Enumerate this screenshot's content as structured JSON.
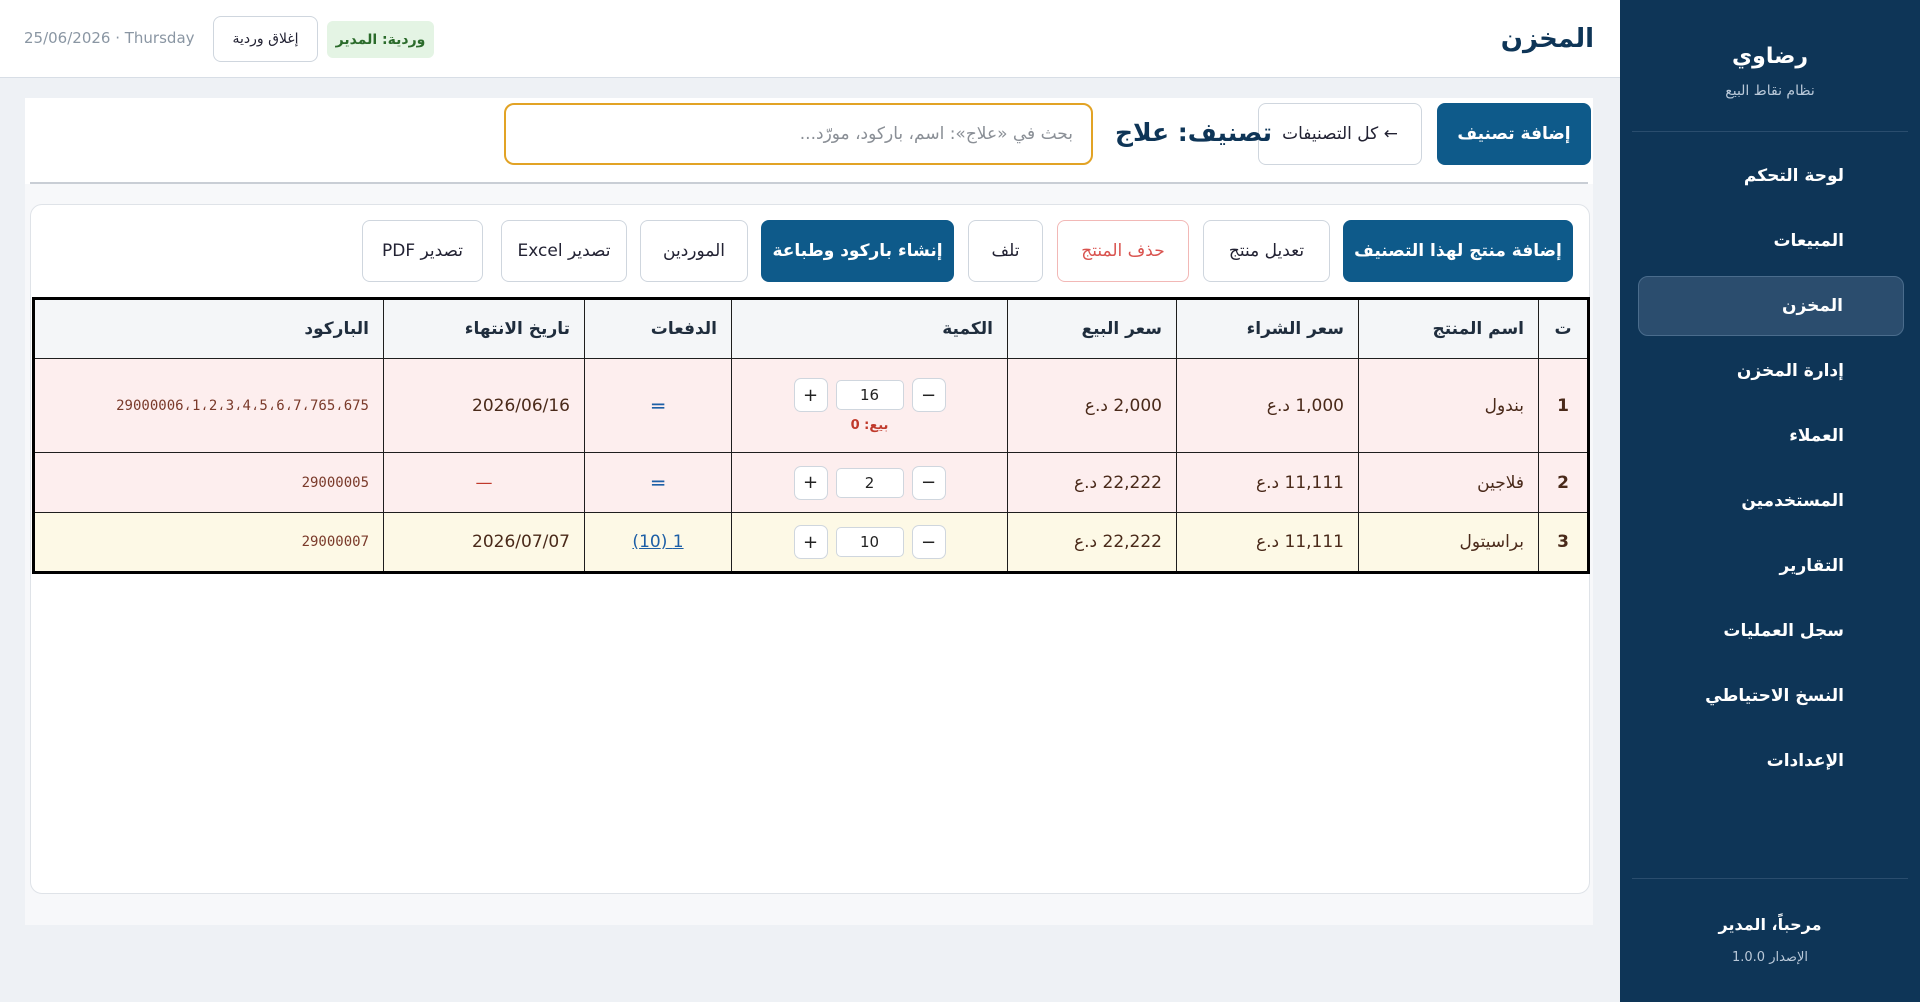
{
  "sidebar": {
    "brand": "رضاوي",
    "subtitle": "نظام نقاط البيع",
    "items": [
      {
        "label": "لوحة التحكم"
      },
      {
        "label": "المبيعات"
      },
      {
        "label": "المخزن"
      },
      {
        "label": "إدارة المخزن"
      },
      {
        "label": "العملاء"
      },
      {
        "label": "المستخدمين"
      },
      {
        "label": "التقارير"
      },
      {
        "label": "سجل العمليات"
      },
      {
        "label": "النسخ الاحتياطي"
      },
      {
        "label": "الإعدادات"
      }
    ],
    "active_index": 2,
    "welcome": "مرحباً، المدير",
    "version": "الإصدار 1.0.0"
  },
  "topbar": {
    "title": "المخزن",
    "shift_badge": "وردية: المدير",
    "close_shift": "إغلاق وردية",
    "date": "25/06/2026 · Thursday"
  },
  "category_bar": {
    "add_category": "إضافة تصنيف",
    "all_categories": "← كل التصنيفات",
    "title": "تصنيف: علاج",
    "search_placeholder": "بحث في «علاج»: اسم، باركود، مورّد..."
  },
  "actions": {
    "add_product": "إضافة منتج لهذا التصنيف",
    "edit_product": "تعديل منتج",
    "delete_product": "حذف المنتج",
    "damage": "تلف",
    "barcode_print": "إنشاء باركود وطباعة",
    "suppliers": "الموردين",
    "export_excel": "تصدير Excel",
    "export_pdf": "تصدير PDF"
  },
  "table": {
    "headers": {
      "index": "ت",
      "name": "اسم المنتج",
      "buy_price": "سعر الشراء",
      "sell_price": "سعر البيع",
      "quantity": "الكمية",
      "batches": "الدفعات",
      "expiry": "تاريخ الانتهاء",
      "barcode": "الباركود"
    },
    "rows": [
      {
        "index": "1",
        "name": "بندول",
        "buy_price": "1,000 د.ع",
        "sell_price": "2,000 د.ع",
        "quantity": "16",
        "sold": "بيع: 0",
        "batches": "═",
        "expiry": "2026/06/16",
        "barcode": "29000006،1،2،3،4،5،6،7،765،675"
      },
      {
        "index": "2",
        "name": "فلاجين",
        "buy_price": "11,111 د.ع",
        "sell_price": "22,222 د.ع",
        "quantity": "2",
        "sold": "",
        "batches": "═",
        "expiry": "—",
        "barcode": "29000005"
      },
      {
        "index": "3",
        "name": "براسيتول",
        "buy_price": "11,111 د.ع",
        "sell_price": "22,222 د.ع",
        "quantity": "10",
        "sold": "",
        "batches": "1 (10)",
        "expiry": "2026/07/07",
        "barcode": "29000007"
      }
    ],
    "minus": "−",
    "plus": "+"
  }
}
